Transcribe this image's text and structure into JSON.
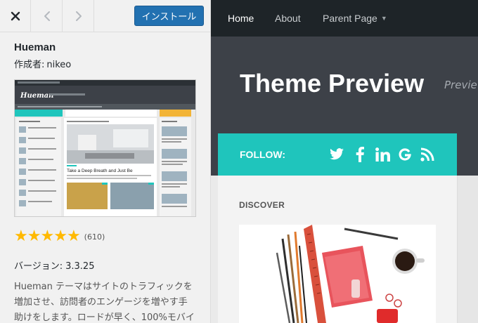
{
  "sidebar": {
    "install_label": "インストール",
    "theme_name": "Hueman",
    "author_label": "作成者:",
    "author_name": "nikeo",
    "rating_count": "(610)",
    "rating_stars": 5,
    "version_label": "バージョン:",
    "version_number": "3.3.25",
    "description": "Hueman テーマはサイトのトラフィックを増加させ、訪問者のエンゲージを増やす手助けをします。ロードが早く、100%モバイ"
  },
  "thumbnail": {
    "site_name": "Hueman",
    "post_title": "Take a Deep Breath and Just Be"
  },
  "preview": {
    "nav": {
      "home": "Home",
      "about": "About",
      "parent": "Parent Page"
    },
    "site_title": "Theme Preview",
    "tagline": "Preview",
    "follow_label": "FOLLOW:",
    "social_icons": [
      "twitter-icon",
      "facebook-icon",
      "linkedin-icon",
      "google-icon",
      "rss-icon"
    ],
    "discover_label": "DISCOVER"
  },
  "colors": {
    "install_button": "#2271b1",
    "follow_bar": "#1fc5bc",
    "header": "#3d4148",
    "nav": "#1e2428",
    "star": "#ffb900"
  }
}
